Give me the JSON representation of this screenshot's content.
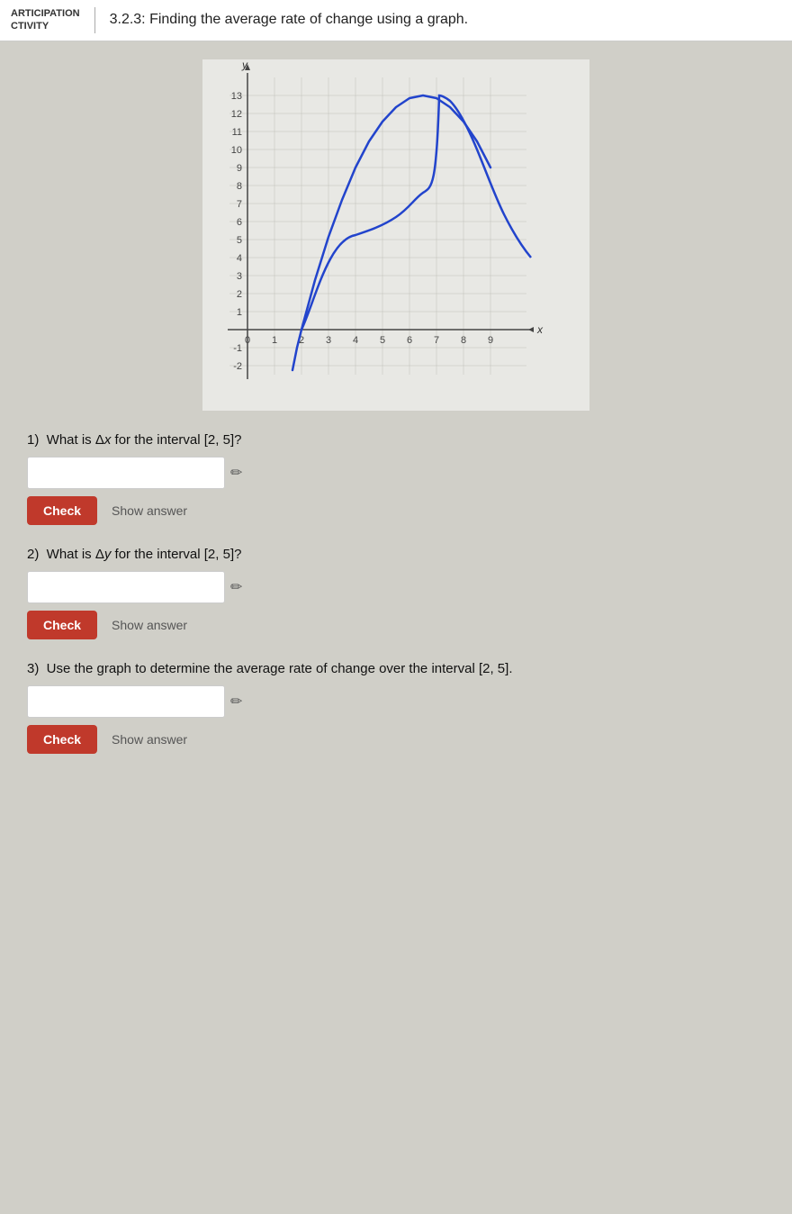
{
  "header": {
    "label_line1": "ARTICIPATION",
    "label_line2": "CTIVITY",
    "title": "3.2.3: Finding the average rate of change using a graph."
  },
  "questions": [
    {
      "id": "q1",
      "text": "1)  What is Δx for the interval [2, 5]?",
      "input_placeholder": "",
      "check_label": "Check",
      "show_answer_label": "Show answer"
    },
    {
      "id": "q2",
      "text": "2)  What is Δy for the interval [2, 5]?",
      "input_placeholder": "",
      "check_label": "Check",
      "show_answer_label": "Show answer"
    },
    {
      "id": "q3",
      "text_line1": "3)  Use the graph to determine the average rate of change over the",
      "text_line2": "interval [2, 5].",
      "input_placeholder": "",
      "check_label": "Check",
      "show_answer_label": "Show answer"
    }
  ],
  "graph": {
    "x_label": "x",
    "y_label": "y"
  }
}
